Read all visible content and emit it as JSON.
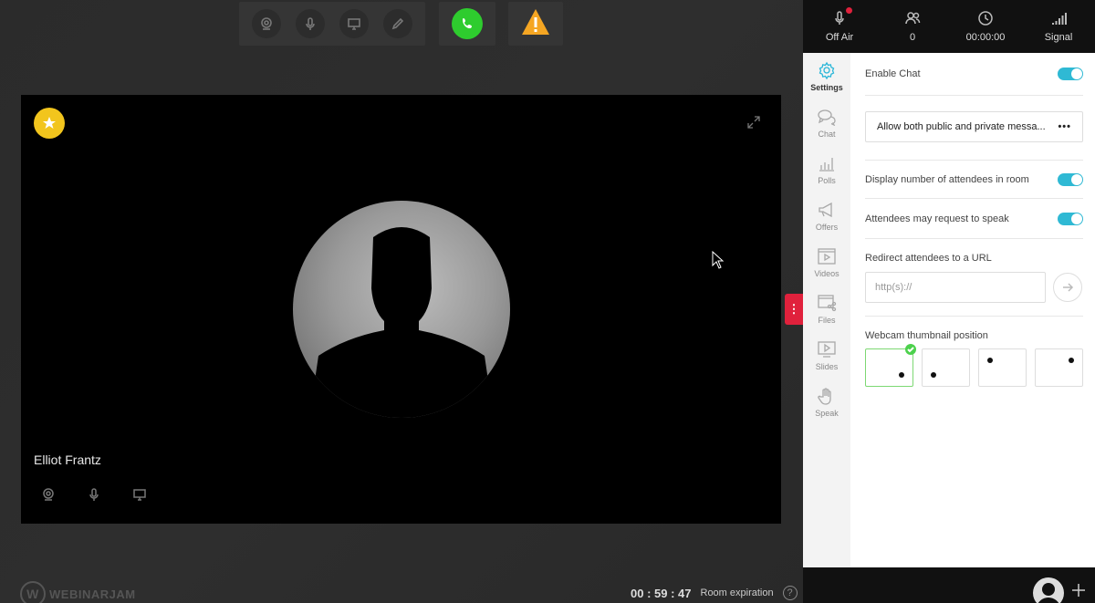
{
  "video": {
    "presenter_name": "Elliot Frantz"
  },
  "status": {
    "off_air": "Off Air",
    "attendees": "0",
    "timer": "00:00:00",
    "signal": "Signal"
  },
  "nav": {
    "items": [
      {
        "label": "Settings"
      },
      {
        "label": "Chat"
      },
      {
        "label": "Polls"
      },
      {
        "label": "Offers"
      },
      {
        "label": "Videos"
      },
      {
        "label": "Files"
      },
      {
        "label": "Slides"
      },
      {
        "label": "Speak"
      }
    ]
  },
  "settings": {
    "enable_chat": "Enable Chat",
    "chat_mode": "Allow both public and private messa...",
    "display_attendees": "Display number of attendees in room",
    "request_speak": "Attendees may request to speak",
    "redirect_label": "Redirect attendees to a URL",
    "redirect_placeholder": "http(s)://",
    "thumb_label": "Webcam thumbnail position"
  },
  "footer": {
    "brand": "WEBINARJAM",
    "countdown": "00 : 59 : 47",
    "expiry_label": "Room expiration"
  },
  "colors": {
    "accent": "#2fb9d4",
    "call_green": "#2ecc2e",
    "warning": "#f5a623",
    "alert_red": "#e0213c"
  }
}
